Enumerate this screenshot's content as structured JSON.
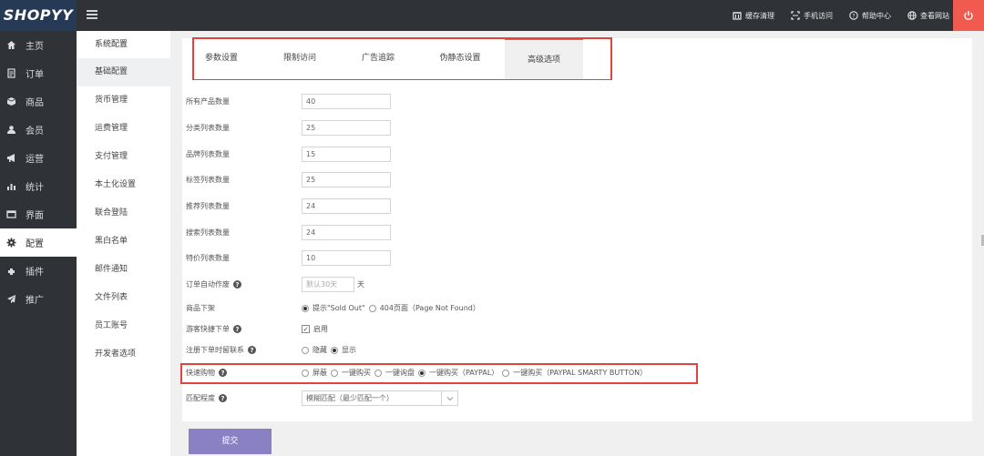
{
  "brand": {
    "logo": "SHOPYY"
  },
  "header": {
    "actions": [
      {
        "label": "缓存清理",
        "icon": "cache-icon"
      },
      {
        "label": "手机访问",
        "icon": "mobile-icon"
      },
      {
        "label": "帮助中心",
        "icon": "help-icon"
      },
      {
        "label": "查看网站",
        "icon": "globe-icon"
      }
    ]
  },
  "sidebar": {
    "items": [
      {
        "label": "主页",
        "icon": "home-icon"
      },
      {
        "label": "订单",
        "icon": "order-icon"
      },
      {
        "label": "商品",
        "icon": "product-icon"
      },
      {
        "label": "会员",
        "icon": "member-icon"
      },
      {
        "label": "运营",
        "icon": "megaphone-icon"
      },
      {
        "label": "统计",
        "icon": "stats-icon"
      },
      {
        "label": "界面",
        "icon": "interface-icon"
      },
      {
        "label": "配置",
        "icon": "gear-icon",
        "active": true
      },
      {
        "label": "插件",
        "icon": "plugin-icon"
      },
      {
        "label": "推广",
        "icon": "send-icon"
      }
    ]
  },
  "submenu": {
    "title": "系统配置",
    "items": [
      "基础配置",
      "货币管理",
      "运费管理",
      "支付管理",
      "本土化设置",
      "联合登陆",
      "黑白名单",
      "邮件通知",
      "文件列表",
      "员工账号",
      "开发者选项"
    ]
  },
  "tabs": [
    "参数设置",
    "限制访问",
    "广告追踪",
    "伪静态设置",
    "高级选项"
  ],
  "form": {
    "fields": [
      {
        "label": "所有产品数量",
        "value": "40"
      },
      {
        "label": "分类列表数量",
        "value": "25"
      },
      {
        "label": "品牌列表数量",
        "value": "15"
      },
      {
        "label": "标签列表数量",
        "value": "25"
      },
      {
        "label": "推荐列表数量",
        "value": "24"
      },
      {
        "label": "搜索列表数量",
        "value": "24"
      },
      {
        "label": "特价列表数量",
        "value": "10"
      }
    ],
    "auto_order": {
      "label": "订单自动作废",
      "placeholder": "默认30天",
      "suffix": "天"
    },
    "sold_out": {
      "label": "商品下架",
      "options": [
        "提示\"Sold Out\"",
        "404页面（Page Not Found）"
      ]
    },
    "guest_checkout": {
      "label": "游客快捷下单",
      "option": "启用"
    },
    "register_contact": {
      "label": "注册下单时留联系",
      "options": [
        "隐藏",
        "显示"
      ]
    },
    "quick_buy": {
      "label": "快速购物",
      "options": [
        "屏蔽",
        "一键购买",
        "一键询盘",
        "一键购买（PAYPAL）",
        "一键购买（PAYPAL SMARTY BUTTON）"
      ]
    },
    "match": {
      "label": "匹配程度",
      "value": "模糊匹配（最少匹配一个）"
    }
  },
  "submit_label": "提交"
}
